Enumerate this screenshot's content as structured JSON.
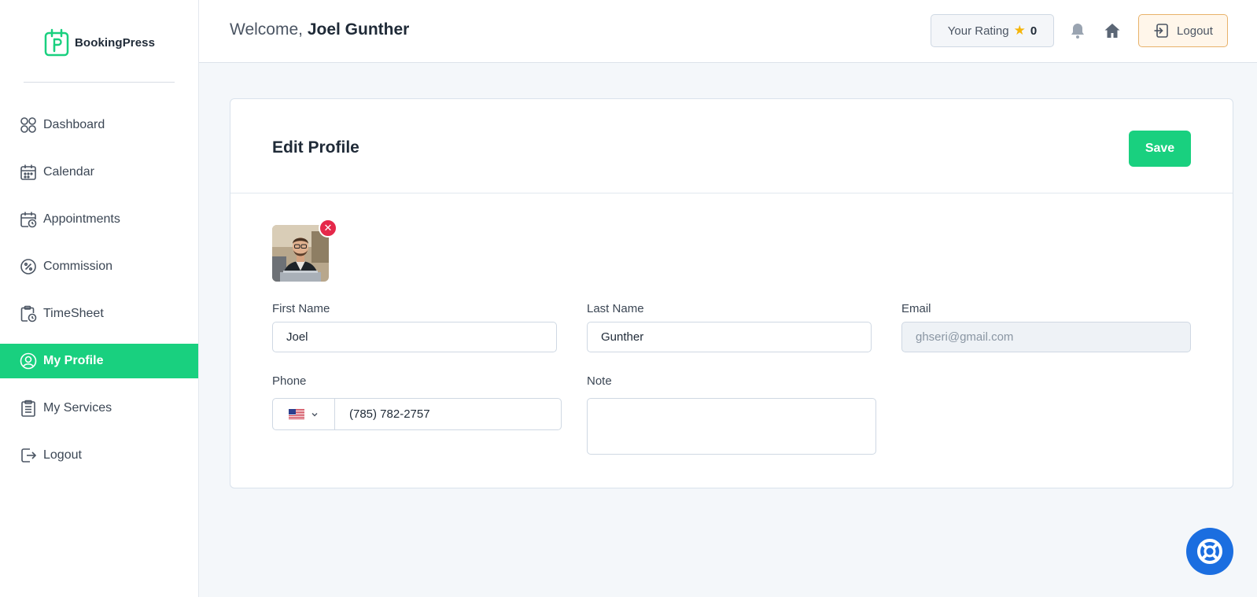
{
  "brand": {
    "name": "BookingPress",
    "accent": "#19d07f"
  },
  "sidebar": {
    "items": [
      {
        "label": "Dashboard",
        "icon": "grid-icon"
      },
      {
        "label": "Calendar",
        "icon": "calendar-icon"
      },
      {
        "label": "Appointments",
        "icon": "calendar-clock-icon"
      },
      {
        "label": "Commission",
        "icon": "percent-badge-icon"
      },
      {
        "label": "TimeSheet",
        "icon": "clipboard-clock-icon"
      },
      {
        "label": "My Profile",
        "icon": "user-circle-icon",
        "active": true
      },
      {
        "label": "My Services",
        "icon": "clipboard-list-icon"
      },
      {
        "label": "Logout",
        "icon": "logout-icon"
      }
    ]
  },
  "header": {
    "welcome_prefix": "Welcome,",
    "user_name": "Joel Gunther",
    "rating_label": "Your Rating",
    "rating_value": "0",
    "logout_label": "Logout"
  },
  "profile": {
    "title": "Edit Profile",
    "save_label": "Save",
    "first_name_label": "First Name",
    "first_name_value": "Joel",
    "last_name_label": "Last Name",
    "last_name_value": "Gunther",
    "email_label": "Email",
    "email_value": "ghseri@gmail.com",
    "phone_label": "Phone",
    "phone_value": "(785) 782-2757",
    "note_label": "Note",
    "note_value": ""
  },
  "colors": {
    "accent": "#19d07f",
    "danger": "#e5284a",
    "help": "#1b6ee0",
    "star": "#f5b50a"
  }
}
